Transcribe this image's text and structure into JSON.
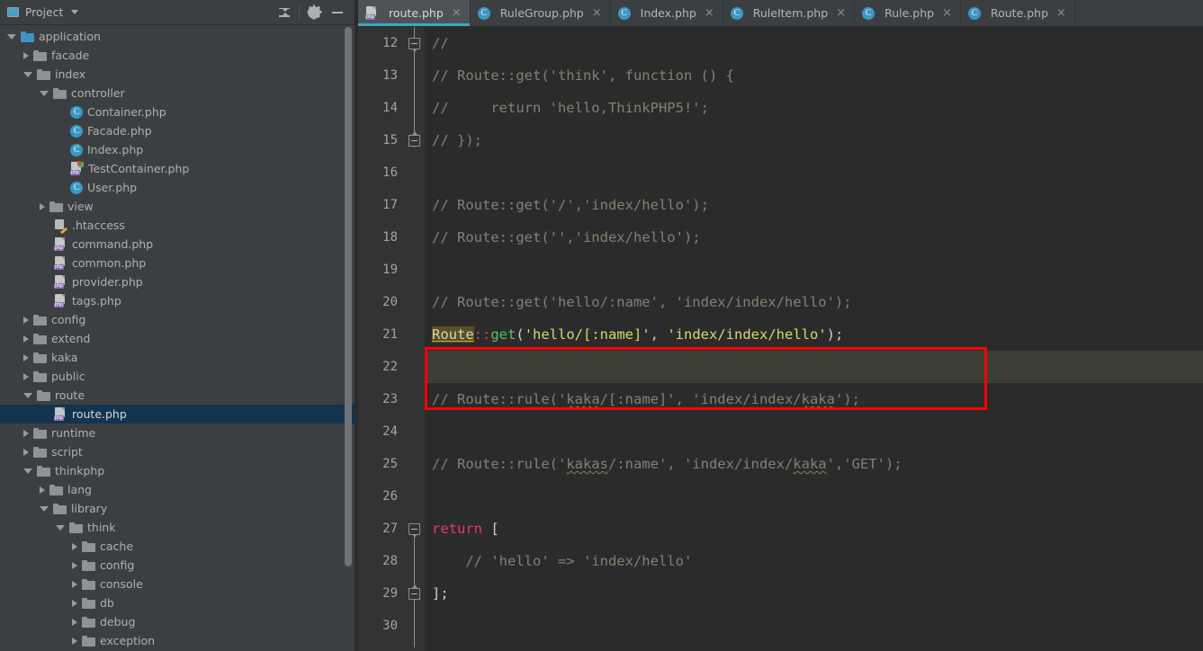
{
  "sidebar": {
    "title": "Project",
    "window_icon": "project-window-icon",
    "dropdown_icon": "chevron-down-icon",
    "tools": [
      {
        "name": "collapse-all-button",
        "icon": "collapse-all-icon"
      },
      {
        "name": "settings-button",
        "icon": "gear-icon"
      },
      {
        "name": "minimize-button",
        "icon": "minus-icon"
      }
    ],
    "tree": [
      {
        "label": "application",
        "indent": 0,
        "arrow": "open",
        "icon": "folder-blue",
        "selected": false
      },
      {
        "label": "facade",
        "indent": 1,
        "arrow": "closed",
        "icon": "folder",
        "selected": false
      },
      {
        "label": "index",
        "indent": 1,
        "arrow": "open",
        "icon": "folder",
        "selected": false
      },
      {
        "label": "controller",
        "indent": 2,
        "arrow": "open",
        "icon": "folder",
        "selected": false
      },
      {
        "label": "Container.php",
        "indent": 3,
        "arrow": "none",
        "icon": "class",
        "selected": false
      },
      {
        "label": "Facade.php",
        "indent": 3,
        "arrow": "none",
        "icon": "class",
        "selected": false
      },
      {
        "label": "Index.php",
        "indent": 3,
        "arrow": "none",
        "icon": "class",
        "selected": false
      },
      {
        "label": "TestContainer.php",
        "indent": 3,
        "arrow": "none",
        "icon": "php-test",
        "selected": false
      },
      {
        "label": "User.php",
        "indent": 3,
        "arrow": "none",
        "icon": "class",
        "selected": false
      },
      {
        "label": "view",
        "indent": 2,
        "arrow": "closed",
        "icon": "folder",
        "selected": false
      },
      {
        "label": ".htaccess",
        "indent": 2,
        "arrow": "none",
        "icon": "htaccess",
        "selected": false
      },
      {
        "label": "command.php",
        "indent": 2,
        "arrow": "none",
        "icon": "php",
        "selected": false
      },
      {
        "label": "common.php",
        "indent": 2,
        "arrow": "none",
        "icon": "php",
        "selected": false
      },
      {
        "label": "provider.php",
        "indent": 2,
        "arrow": "none",
        "icon": "php",
        "selected": false
      },
      {
        "label": "tags.php",
        "indent": 2,
        "arrow": "none",
        "icon": "php",
        "selected": false
      },
      {
        "label": "config",
        "indent": 1,
        "arrow": "closed",
        "icon": "folder",
        "selected": false
      },
      {
        "label": "extend",
        "indent": 1,
        "arrow": "closed",
        "icon": "folder",
        "selected": false
      },
      {
        "label": "kaka",
        "indent": 1,
        "arrow": "closed",
        "icon": "folder",
        "selected": false
      },
      {
        "label": "public",
        "indent": 1,
        "arrow": "closed",
        "icon": "folder",
        "selected": false
      },
      {
        "label": "route",
        "indent": 1,
        "arrow": "open",
        "icon": "folder",
        "selected": false
      },
      {
        "label": "route.php",
        "indent": 2,
        "arrow": "none",
        "icon": "php",
        "selected": true
      },
      {
        "label": "runtime",
        "indent": 1,
        "arrow": "closed",
        "icon": "folder",
        "selected": false
      },
      {
        "label": "script",
        "indent": 1,
        "arrow": "closed",
        "icon": "folder",
        "selected": false
      },
      {
        "label": "thinkphp",
        "indent": 1,
        "arrow": "open",
        "icon": "folder",
        "selected": false
      },
      {
        "label": "lang",
        "indent": 2,
        "arrow": "closed",
        "icon": "folder",
        "selected": false
      },
      {
        "label": "library",
        "indent": 2,
        "arrow": "open",
        "icon": "folder",
        "selected": false
      },
      {
        "label": "think",
        "indent": 3,
        "arrow": "open",
        "icon": "folder",
        "selected": false
      },
      {
        "label": "cache",
        "indent": 4,
        "arrow": "closed",
        "icon": "folder",
        "selected": false
      },
      {
        "label": "config",
        "indent": 4,
        "arrow": "closed",
        "icon": "folder",
        "selected": false
      },
      {
        "label": "console",
        "indent": 4,
        "arrow": "closed",
        "icon": "folder",
        "selected": false
      },
      {
        "label": "db",
        "indent": 4,
        "arrow": "closed",
        "icon": "folder",
        "selected": false
      },
      {
        "label": "debug",
        "indent": 4,
        "arrow": "closed",
        "icon": "folder",
        "selected": false
      },
      {
        "label": "exception",
        "indent": 4,
        "arrow": "closed",
        "icon": "folder",
        "selected": false
      }
    ]
  },
  "editor": {
    "tabs": [
      {
        "label": "route.php",
        "icon": "php-file-icon",
        "active": true,
        "close": "×"
      },
      {
        "label": "RuleGroup.php",
        "icon": "php-class-icon",
        "active": false,
        "close": "×"
      },
      {
        "label": "Index.php",
        "icon": "php-class-icon",
        "active": false,
        "close": "×"
      },
      {
        "label": "RuleItem.php",
        "icon": "php-class-icon",
        "active": false,
        "close": "×"
      },
      {
        "label": "Rule.php",
        "icon": "php-class-icon",
        "active": false,
        "close": "×"
      },
      {
        "label": "Route.php",
        "icon": "php-class-icon",
        "active": false,
        "close": "×"
      }
    ],
    "first_line_number": 12,
    "line_numbers": [
      12,
      13,
      14,
      15,
      16,
      17,
      18,
      19,
      20,
      21,
      22,
      23,
      24,
      25,
      26,
      27,
      28,
      29,
      30
    ],
    "current_line": 22,
    "highlight_box_lines": [
      21,
      22
    ],
    "lines": [
      {
        "n": 12,
        "tokens": [
          {
            "t": "//",
            "c": "cmt"
          }
        ]
      },
      {
        "n": 13,
        "tokens": [
          {
            "t": "// Route::get('think', function () {",
            "c": "cmt"
          }
        ]
      },
      {
        "n": 14,
        "tokens": [
          {
            "t": "//     return 'hello,ThinkPHP5!';",
            "c": "cmt"
          }
        ]
      },
      {
        "n": 15,
        "tokens": [
          {
            "t": "// });",
            "c": "cmt"
          }
        ]
      },
      {
        "n": 16,
        "tokens": []
      },
      {
        "n": 17,
        "tokens": [
          {
            "t": "// Route::get('/','index/hello');",
            "c": "cmt"
          }
        ]
      },
      {
        "n": 18,
        "tokens": [
          {
            "t": "// Route::get('','index/hello');",
            "c": "cmt"
          }
        ]
      },
      {
        "n": 19,
        "tokens": []
      },
      {
        "n": 20,
        "tokens": [
          {
            "t": "// Route::get('hello/:name', 'index/index/hello');",
            "c": "cmt"
          }
        ]
      },
      {
        "n": 21,
        "tokens": [
          {
            "t": "Route",
            "c": "ident-hl"
          },
          {
            "t": "::",
            "c": "op"
          },
          {
            "t": "get",
            "c": "fn"
          },
          {
            "t": "(",
            "c": "pun"
          },
          {
            "t": "'hello/[:name]'",
            "c": "str"
          },
          {
            "t": ", ",
            "c": "pun"
          },
          {
            "t": "'index/index/hello'",
            "c": "str"
          },
          {
            "t": ");",
            "c": "pun"
          }
        ]
      },
      {
        "n": 22,
        "tokens": []
      },
      {
        "n": 23,
        "tokens": [
          {
            "t": "// Route::rule(",
            "c": "cmt"
          },
          {
            "t": "'",
            "c": "cmt"
          },
          {
            "t": "kaka",
            "c": "cmt typo"
          },
          {
            "t": "/[:name]', 'index/index/",
            "c": "cmt"
          },
          {
            "t": "kaka",
            "c": "cmt typo"
          },
          {
            "t": "');",
            "c": "cmt"
          }
        ]
      },
      {
        "n": 24,
        "tokens": []
      },
      {
        "n": 25,
        "tokens": [
          {
            "t": "// Route::rule('",
            "c": "cmt"
          },
          {
            "t": "kakas",
            "c": "cmt typo"
          },
          {
            "t": "/:name', 'index/index/",
            "c": "cmt"
          },
          {
            "t": "kaka",
            "c": "cmt typo"
          },
          {
            "t": "','GET');",
            "c": "cmt"
          }
        ]
      },
      {
        "n": 26,
        "tokens": []
      },
      {
        "n": 27,
        "tokens": [
          {
            "t": "return",
            "c": "kw"
          },
          {
            "t": " [",
            "c": "pun"
          }
        ]
      },
      {
        "n": 28,
        "tokens": [
          {
            "t": "    // 'hello' => 'index/hello'",
            "c": "cmt"
          }
        ]
      },
      {
        "n": 29,
        "tokens": [
          {
            "t": "];",
            "c": "pun"
          }
        ]
      },
      {
        "n": 30,
        "tokens": []
      }
    ],
    "fold_markers": [
      {
        "line": 12,
        "type": "start"
      },
      {
        "line": 15,
        "type": "end"
      },
      {
        "line": 27,
        "type": "start"
      },
      {
        "line": 29,
        "type": "end"
      }
    ]
  },
  "colors": {
    "sidebar_bg": "#3c3f41",
    "editor_bg": "#2b2b2b",
    "gutter_bg": "#313335",
    "tab_active_bg": "#4e5254",
    "tab_underline": "#3aa9c4",
    "selection_blue": "#13344f",
    "current_line_bg": "#3c3f36",
    "annotation_red": "#ff0000",
    "comment": "#7f8372",
    "string": "#d8d86a",
    "keyword": "#e8386e",
    "function": "#5ac25a"
  }
}
